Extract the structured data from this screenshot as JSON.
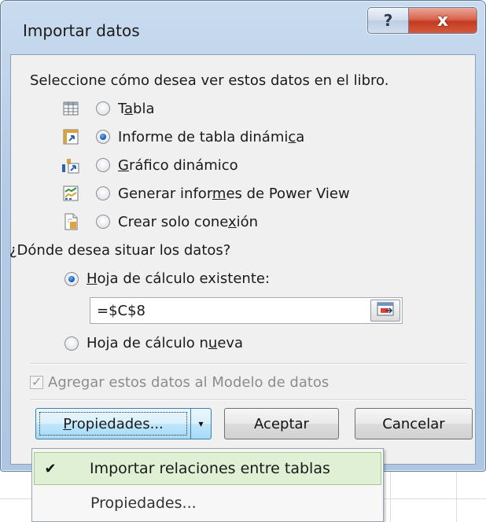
{
  "window": {
    "title": "Importar datos",
    "help_label": "?",
    "close_label": "x"
  },
  "view_section": {
    "heading": "Seleccione cómo desea ver estos datos en el libro.",
    "options": [
      {
        "icon": "table-icon",
        "pre": "T",
        "accel": "a",
        "post": "bla",
        "selected": false
      },
      {
        "icon": "pivot-table-icon",
        "pre": "Informe de tabla dinámi",
        "accel": "c",
        "post": "a",
        "selected": true
      },
      {
        "icon": "pivot-chart-icon",
        "pre": "",
        "accel": "G",
        "post": "ráfico dinámico",
        "selected": false
      },
      {
        "icon": "power-view-icon",
        "pre": "Generar infor",
        "accel": "m",
        "post": "es de Power View",
        "selected": false
      },
      {
        "icon": "connection-only-icon",
        "pre": "Crear solo cone",
        "accel": "x",
        "post": "ión",
        "selected": false
      }
    ]
  },
  "location_section": {
    "heading": "¿Dónde desea situar los datos?",
    "existing": {
      "pre": "",
      "accel": "H",
      "post": "oja de cálculo existente:",
      "selected": true
    },
    "cell_ref": "=$C$8",
    "new_sheet": {
      "pre": "Hoja de cálculo n",
      "accel": "u",
      "post": "eva",
      "selected": false
    }
  },
  "data_model": {
    "label": "Agregar estos datos al Modelo de datos",
    "checked": true,
    "enabled": false
  },
  "buttons": {
    "properties_pre": "",
    "properties_accel": "P",
    "properties_post": "ropiedades...",
    "dropdown_arrow": "▾",
    "accept": "Aceptar",
    "cancel": "Cancelar"
  },
  "dropdown_menu": {
    "items": [
      {
        "label": "Importar relaciones entre tablas",
        "checked": true,
        "check_glyph": "✔"
      },
      {
        "label": "Propiedades...",
        "checked": false
      }
    ]
  }
}
